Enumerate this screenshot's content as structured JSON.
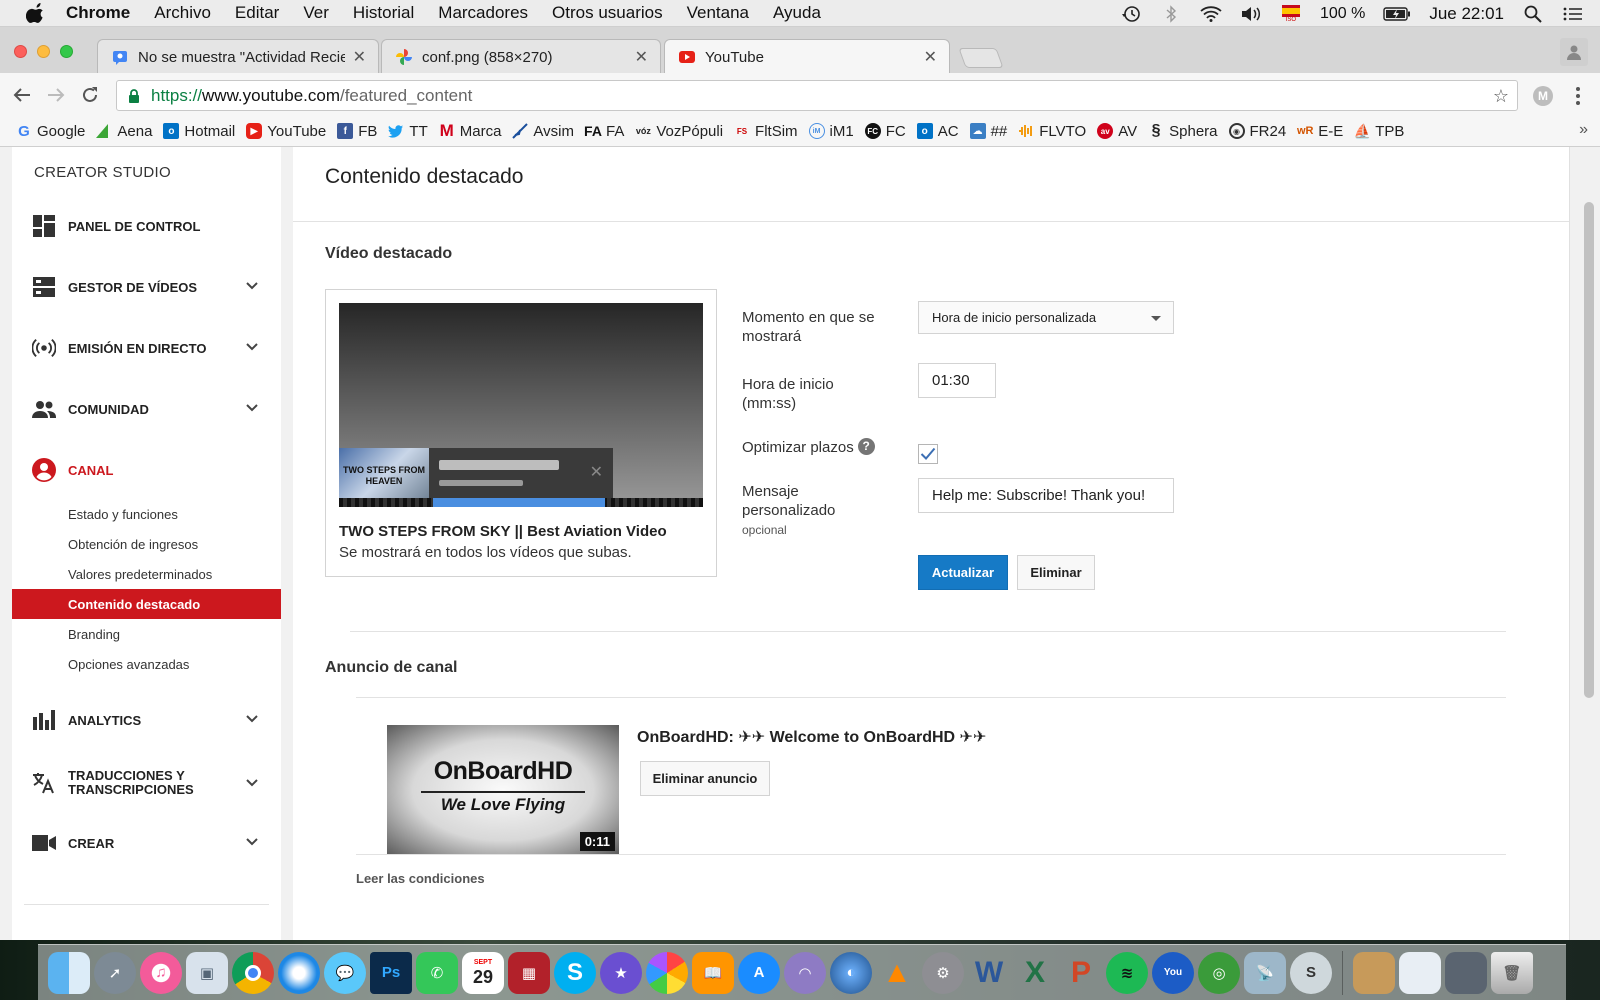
{
  "menubar": {
    "app": "Chrome",
    "items": [
      "Archivo",
      "Editar",
      "Ver",
      "Historial",
      "Marcadores",
      "Otros usuarios",
      "Ventana",
      "Ayuda"
    ],
    "battery": "100 %",
    "clock": "Jue 22:01",
    "flag_label": "ISO"
  },
  "browser": {
    "tabs": [
      {
        "title": "No se muestra \"Actividad Reciente\""
      },
      {
        "title": "conf.png (858×270)"
      },
      {
        "title": "YouTube"
      }
    ],
    "url_scheme": "https://",
    "url_host": "www.youtube.com",
    "url_path": "/featured_content",
    "profile_initial": "M",
    "bookmarks": [
      "Google",
      "Aena",
      "Hotmail",
      "YouTube",
      "FB",
      "TT",
      "Marca",
      "Avsim",
      "FA",
      "VozPópuli",
      "FltSim",
      "iM1",
      "FC",
      "AC",
      "##",
      "FLVTO",
      "AV",
      "Sphera",
      "FR24",
      "E-E",
      "TPB"
    ],
    "bookmark_overflow": "»"
  },
  "sidebar": {
    "title": "CREATOR STUDIO",
    "nav": {
      "panel": "PANEL DE CONTROL",
      "gestor": "GESTOR DE VÍDEOS",
      "emision": "EMISIÓN EN DIRECTO",
      "comunidad": "COMUNIDAD",
      "canal": "CANAL",
      "analytics": "ANALYTICS",
      "traducciones_1": "TRADUCCIONES Y",
      "traducciones_2": "TRANSCRIPCIONES",
      "crear": "CREAR"
    },
    "canal_sub": [
      "Estado y funciones",
      "Obtención de ingresos",
      "Valores predeterminados",
      "Contenido destacado",
      "Branding",
      "Opciones avanzadas"
    ]
  },
  "main": {
    "title": "Contenido destacado",
    "featured": {
      "section_title": "Vídeo destacado",
      "thumb_text": "TWO STEPS FROM HEAVEN",
      "video_title": "TWO STEPS FROM SKY || Best Aviation Video",
      "note": "Se mostrará en todos los vídeos que subas.",
      "label_when_1": "Momento en que se",
      "label_when_2": "mostrará",
      "when_value": "Hora de inicio personalizada",
      "label_start_1": "Hora de inicio",
      "label_start_2": "(mm:ss)",
      "start_value": "01:30",
      "label_optimize": "Optimizar plazos",
      "optimize_checked": true,
      "label_msg_1": "Mensaje",
      "label_msg_2": "personalizado",
      "label_msg_optional": "opcional",
      "msg_value": "Help me: Subscribe! Thank you!",
      "update_btn": "Actualizar",
      "delete_btn": "Eliminar"
    },
    "announcement": {
      "section_title": "Anuncio de canal",
      "logo": "OnBoardHD",
      "tagline": "We Love Flying",
      "duration": "0:11",
      "title": "OnBoardHD: ✈✈ Welcome to OnBoardHD ✈✈",
      "delete_btn": "Eliminar anuncio",
      "terms": "Leer las condiciones"
    }
  },
  "dock": {
    "calendar_month": "SEPT",
    "calendar_day": "29"
  },
  "colors": {
    "youtube_red": "#cc181e",
    "primary_blue": "#167ac6",
    "url_green": "#0b8043"
  }
}
